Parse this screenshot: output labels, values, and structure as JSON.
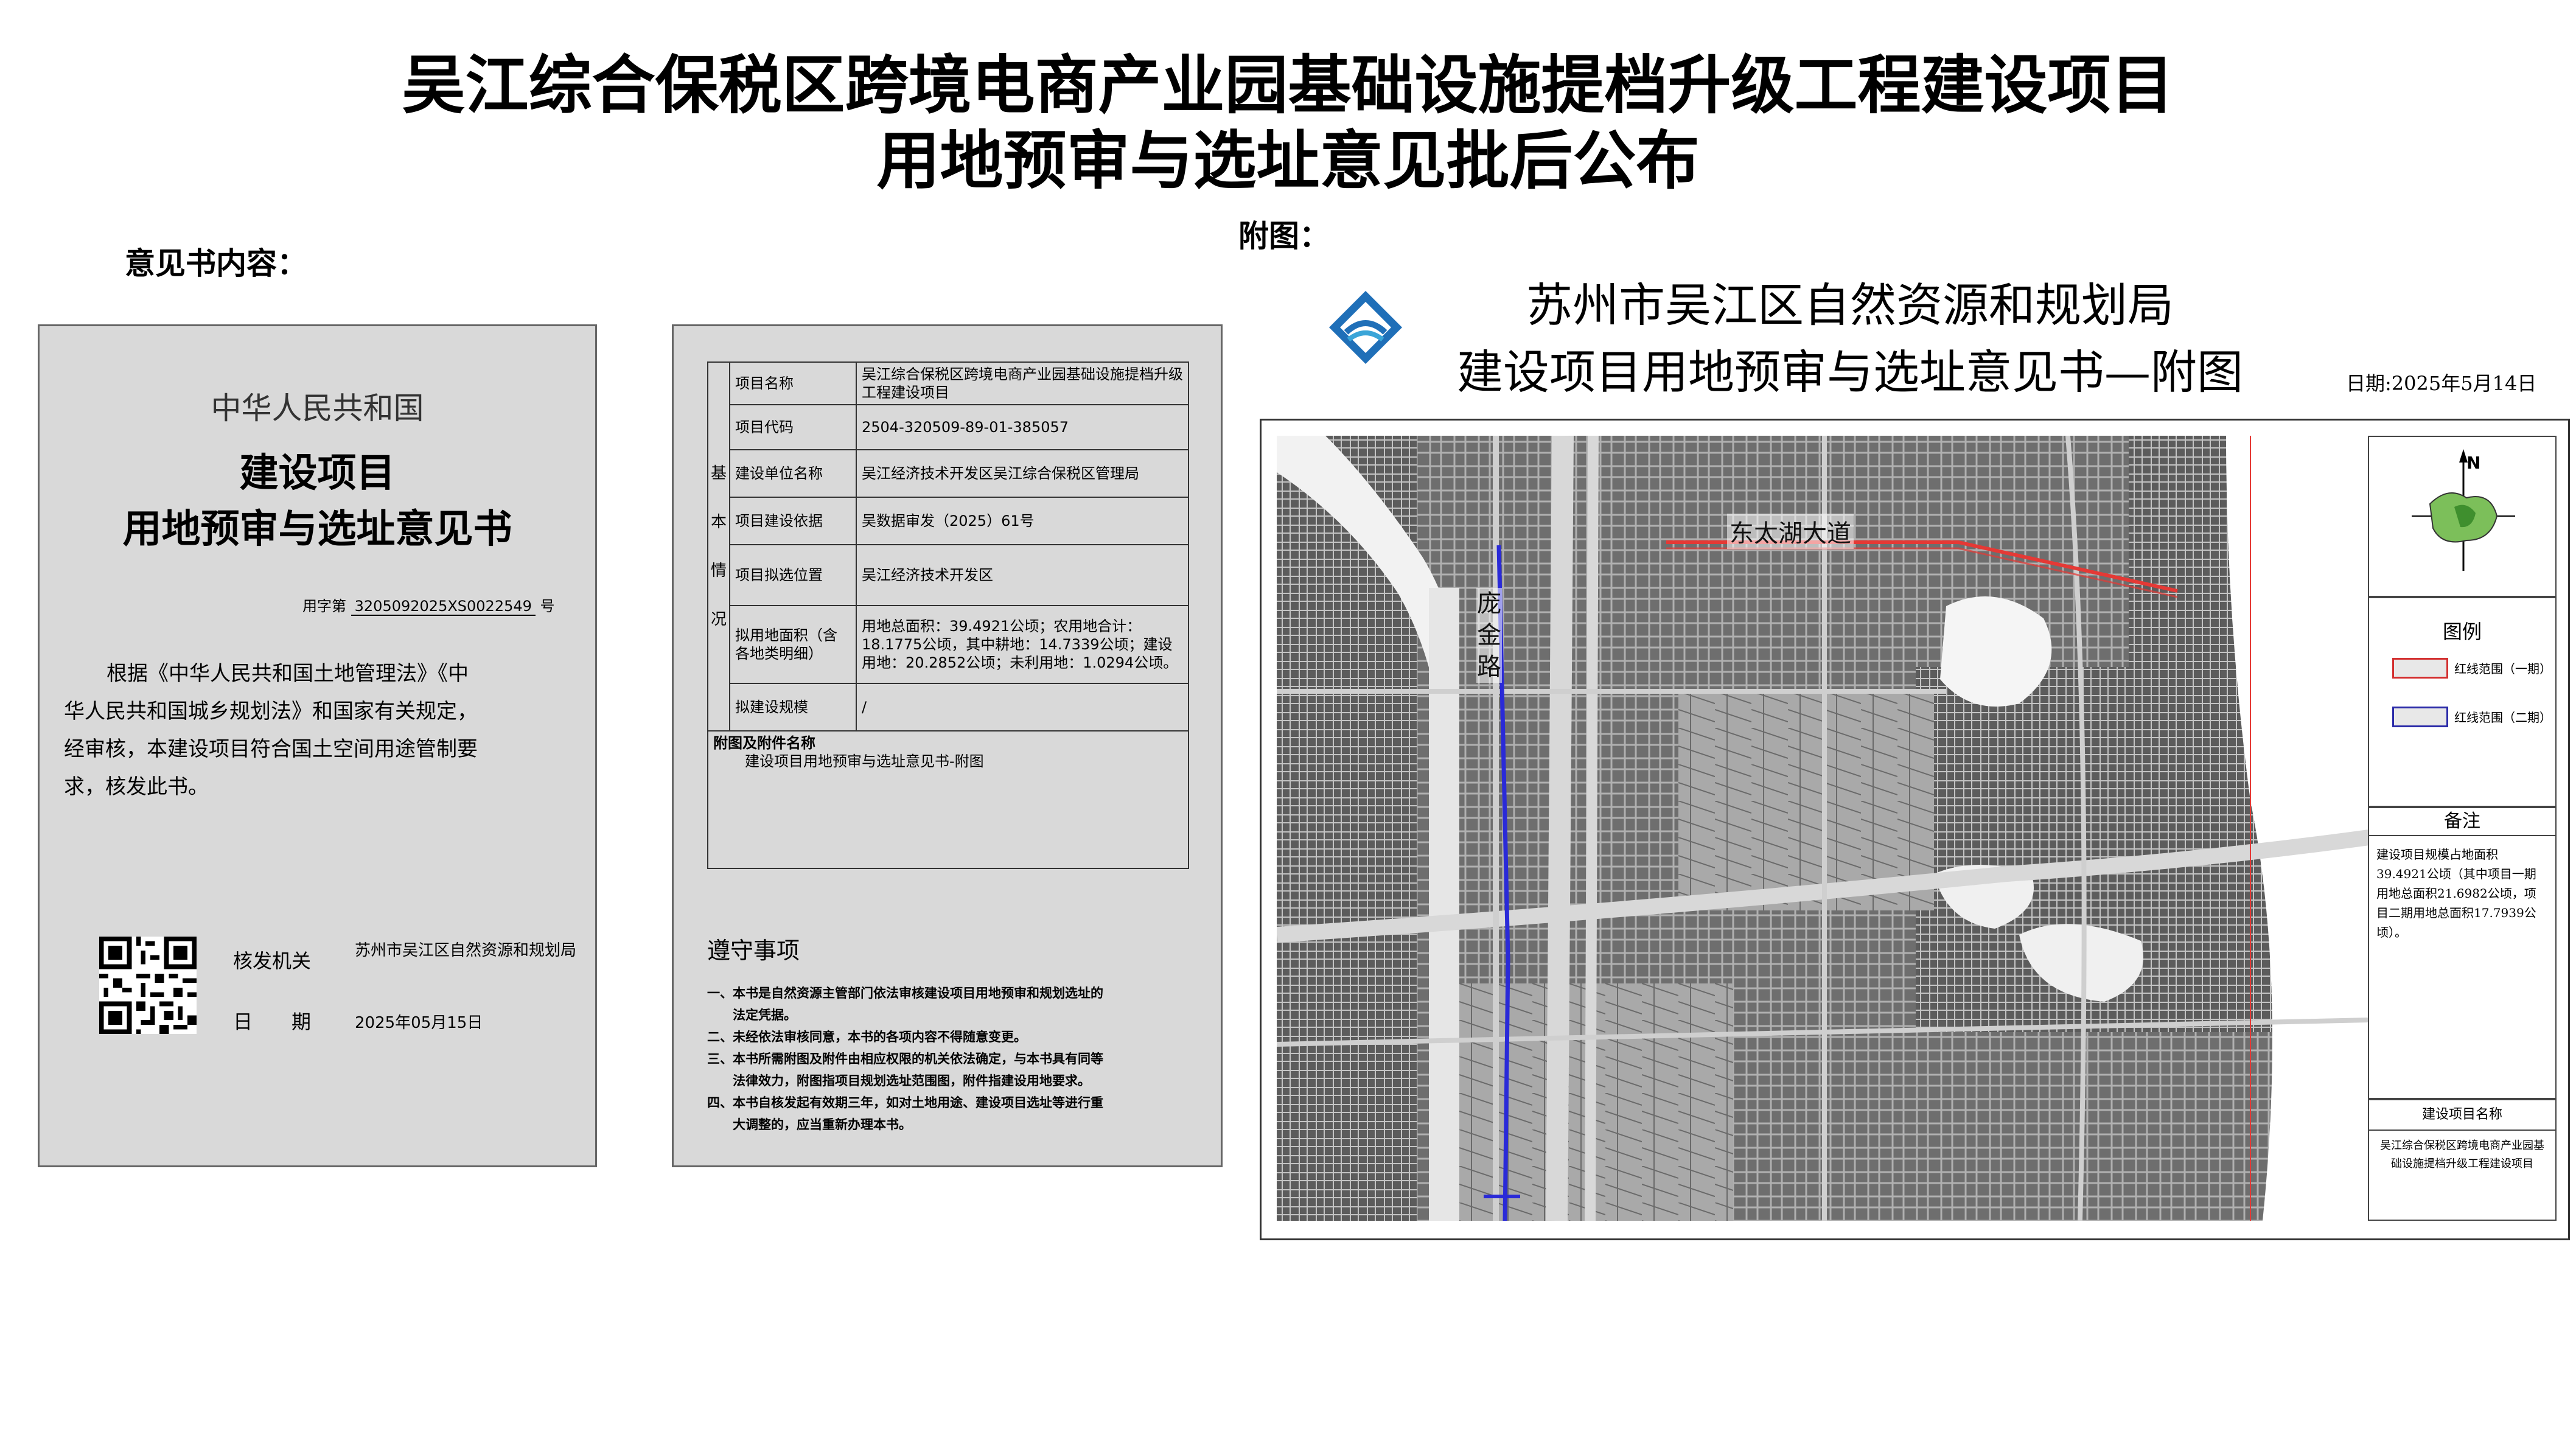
{
  "title": {
    "line1": "吴江综合保税区跨境电商产业园基础设施提档升级工程建设项目",
    "line2": "用地预审与选址意见批后公布"
  },
  "labels": {
    "opinion_content": "意见书内容：",
    "attached_figure": "附图："
  },
  "panel1": {
    "country": "中华人民共和国",
    "doc_title_line1": "建设项目",
    "doc_title_line2": "用地预审与选址意见书",
    "number_prefix": "用字第",
    "number": "3205092025XS0022549",
    "number_suffix": "号",
    "body_lines": [
      "根据《中华人民共和国土地管理法》《中",
      "华人民共和国城乡规划法》和国家有关规定，",
      "经审核，本建设项目符合国土空间用途管制要",
      "求，核发此书。"
    ],
    "issuer_label": "核发机关",
    "issuer_value": "苏州市吴江区自然资源和规划局",
    "date_label": "日　　期",
    "date_value": "2025年05月15日"
  },
  "panel2": {
    "section_label": "基本情况",
    "rows": [
      {
        "label": "项目名称",
        "value": "吴江综合保税区跨境电商产业园基础设施提档升级工程建设项目"
      },
      {
        "label": "项目代码",
        "value": "2504-320509-89-01-385057"
      },
      {
        "label": "建设单位名称",
        "value": "吴江经济技术开发区吴江综合保税区管理局"
      },
      {
        "label": "项目建设依据",
        "value": "吴数据审发（2025）61号"
      },
      {
        "label": "项目拟选位置",
        "value": "吴江经济技术开发区"
      },
      {
        "label": "拟用地面积（含各地类明细）",
        "value": "用地总面积：39.4921公顷；农用地合计：18.1775公顷，其中耕地：14.7339公顷；建设用地：20.2852公顷；未利用地：1.0294公顷。"
      },
      {
        "label": "拟建设规模",
        "value": "/"
      }
    ],
    "attachment_label": "附图及附件名称",
    "attachment_value": "建设项目用地预审与选址意见书-附图",
    "rules_title": "遵守事项",
    "rules": [
      "一、本书是自然资源主管部门依法审核建设项目用地预审和规划选址的",
      "　　法定凭据。",
      "二、未经依法审核同意，本书的各项内容不得随意变更。",
      "三、本书所需附图及附件由相应权限的机关依法确定，与本书具有同等",
      "　　法律效力，附图指项目规划选址范围图，附件指建设用地要求。",
      "四、本书自核发起有效期三年，如对土地用途、建设项目选址等进行重",
      "　　大调整的，应当重新办理本书。"
    ]
  },
  "map_header": {
    "org": "苏州市吴江区自然资源和规划局",
    "subtitle": "建设项目用地预审与选址意见书—附图",
    "date": "日期:2025年5月14日"
  },
  "map": {
    "road_label_east": "东太湖大道",
    "road_label_west": "庞金路",
    "north": "N",
    "legend_title": "图例",
    "legend_items": [
      {
        "label": "红线范围（一期）",
        "color": "#d32f2f"
      },
      {
        "label": "红线范围（二期）",
        "color": "#2a2aa8"
      }
    ],
    "remarks_title": "备注",
    "remarks_text": "建设项目规模占地面积39.4921公顷（其中项目一期用地总面积21.6982公顷，项目二期用地总面积17.7939公顷）。",
    "project_name_title": "建设项目名称",
    "project_name_value": "吴江综合保税区跨境电商产业园基础设施提档升级工程建设项目"
  }
}
